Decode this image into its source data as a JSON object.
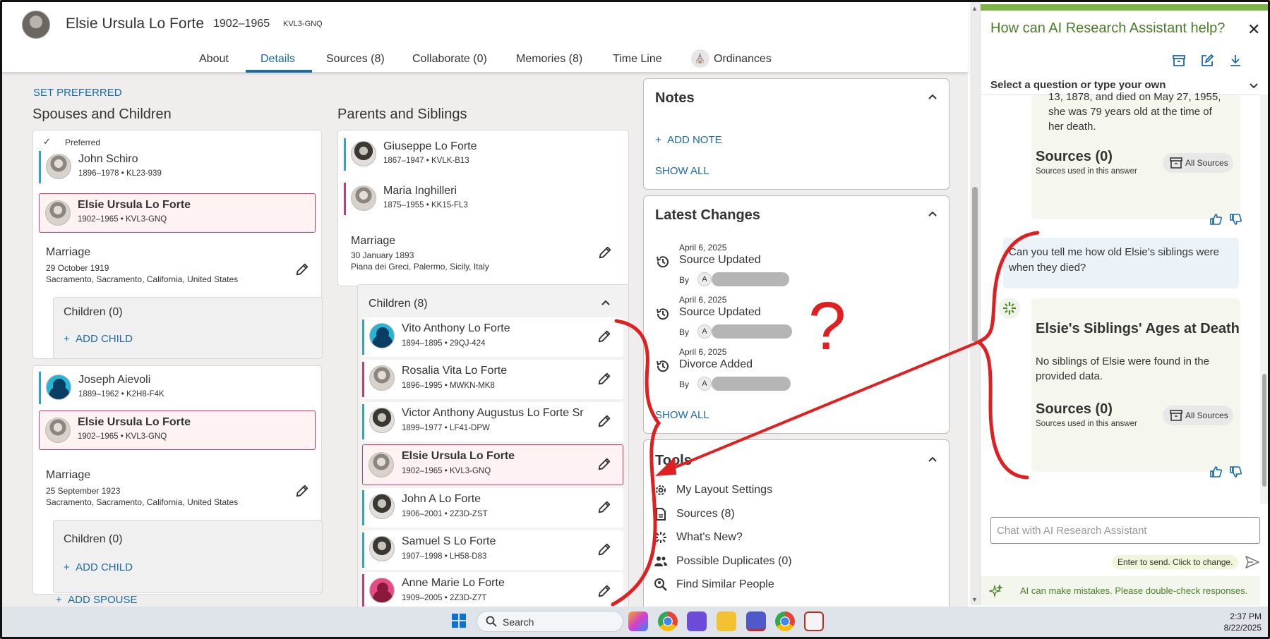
{
  "header": {
    "name": "Elsie Ursula Lo Forte",
    "years": "1902–1965",
    "pid": "KVL3-GNQ",
    "tabs": [
      {
        "label": "About"
      },
      {
        "label": "Details"
      },
      {
        "label": "Sources (8)"
      },
      {
        "label": "Collaborate (0)"
      },
      {
        "label": "Memories (8)"
      },
      {
        "label": "Time Line"
      },
      {
        "label": "Ordinances"
      }
    ]
  },
  "set_preferred": "SET PREFERRED",
  "spouses": {
    "title": "Spouses and Children",
    "preferred_label": "Preferred",
    "families": [
      {
        "spouse": {
          "name": "John Schiro",
          "meta": "1896–1978 • KL23-939"
        },
        "self": {
          "name": "Elsie Ursula Lo Forte",
          "meta": "1902–1965 • KVL3-GNQ"
        },
        "marriage_label": "Marriage",
        "marriage_date": "29 October 1919",
        "marriage_place": "Sacramento, Sacramento, California, United States",
        "children_label": "Children (0)",
        "add_child": "ADD CHILD"
      },
      {
        "spouse": {
          "name": "Joseph Aievoli",
          "meta": "1889–1962 • K2H8-F4K"
        },
        "self": {
          "name": "Elsie Ursula Lo Forte",
          "meta": "1902–1965 • KVL3-GNQ"
        },
        "marriage_label": "Marriage",
        "marriage_date": "25 September 1923",
        "marriage_place": "Sacramento, Sacramento, California, United States",
        "children_label": "Children (0)",
        "add_child": "ADD CHILD"
      }
    ],
    "add_spouse": "ADD SPOUSE"
  },
  "parents": {
    "title": "Parents and Siblings",
    "father": {
      "name": "Giuseppe Lo Forte",
      "meta": "1867–1947 • KVLK-B13"
    },
    "mother": {
      "name": "Maria Inghilleri",
      "meta": "1875–1955 • KK15-FL3"
    },
    "marriage_label": "Marriage",
    "marriage_date": "30 January 1893",
    "marriage_place": "Piana dei Greci, Palermo, Sicily, Italy",
    "children_label": "Children (8)",
    "children": [
      {
        "name": "Vito Anthony Lo Forte",
        "meta": "1894–1895 • 29QJ-424"
      },
      {
        "name": "Rosalia Vita Lo Forte",
        "meta": "1896–1995 • MWKN-MK8"
      },
      {
        "name": "Victor Anthony Augustus Lo Forte Sr",
        "meta": "1899–1977 • LF41-DPW"
      },
      {
        "name": "Elsie Ursula Lo Forte",
        "meta": "1902–1965 • KVL3-GNQ"
      },
      {
        "name": "John A Lo Forte",
        "meta": "1906–2001 • 2Z3D-ZST"
      },
      {
        "name": "Samuel S Lo Forte",
        "meta": "1907–1998 • LH58-D83"
      },
      {
        "name": "Anne Marie Lo Forte",
        "meta": "1909–2005 • 2Z3D-Z7T"
      }
    ]
  },
  "notes": {
    "title": "Notes",
    "add": "ADD NOTE",
    "show_all": "SHOW ALL"
  },
  "changes": {
    "title": "Latest Changes",
    "by": "By",
    "avatar_letter": "A",
    "items": [
      {
        "date": "April 6, 2025",
        "title": "Source Updated"
      },
      {
        "date": "April 6, 2025",
        "title": "Source Updated"
      },
      {
        "date": "April 6, 2025",
        "title": "Divorce Added"
      }
    ],
    "show_all": "SHOW ALL"
  },
  "tools": {
    "title": "Tools",
    "items": [
      {
        "label": "My Layout Settings",
        "icon": "gear-icon"
      },
      {
        "label": "Sources (8)",
        "icon": "document-icon"
      },
      {
        "label": "What's New?",
        "icon": "sparkle-icon"
      },
      {
        "label": "Possible Duplicates (0)",
        "icon": "people-icon"
      },
      {
        "label": "Find Similar People",
        "icon": "search-person-icon"
      }
    ]
  },
  "ai": {
    "title": "How can AI Research Assistant help?",
    "select_label": "Select a question or type your own",
    "prev_answer_lines": [
      "13, 1878, and died on May 27, 1955,",
      "she was 79 years old at the time of",
      "her death."
    ],
    "sources_title": "Sources (0)",
    "sources_sub": "Sources used in this answer",
    "all_sources": "All Sources",
    "question": "Can you tell me how old Elsie's siblings were when they died?",
    "answer_title": "Elsie's Siblings' Ages at Death",
    "answer_text": "No siblings of Elsie were found in the provided data.",
    "input_placeholder": "Chat with AI Research Assistant",
    "send_hint": "Enter to send. Click to change.",
    "footer": "AI can make mistakes. Please double-check responses."
  },
  "taskbar": {
    "search": "Search",
    "time": "2:37 PM",
    "date": "8/22/2025"
  },
  "annotation": {
    "question_mark": "?"
  },
  "colors": {
    "accent_blue": "#1a6aa5",
    "male_bar": "#2ba6c4",
    "female_bar": "#d2386f",
    "ai_green": "#4a7d2a",
    "annotation_red": "#e02020"
  }
}
